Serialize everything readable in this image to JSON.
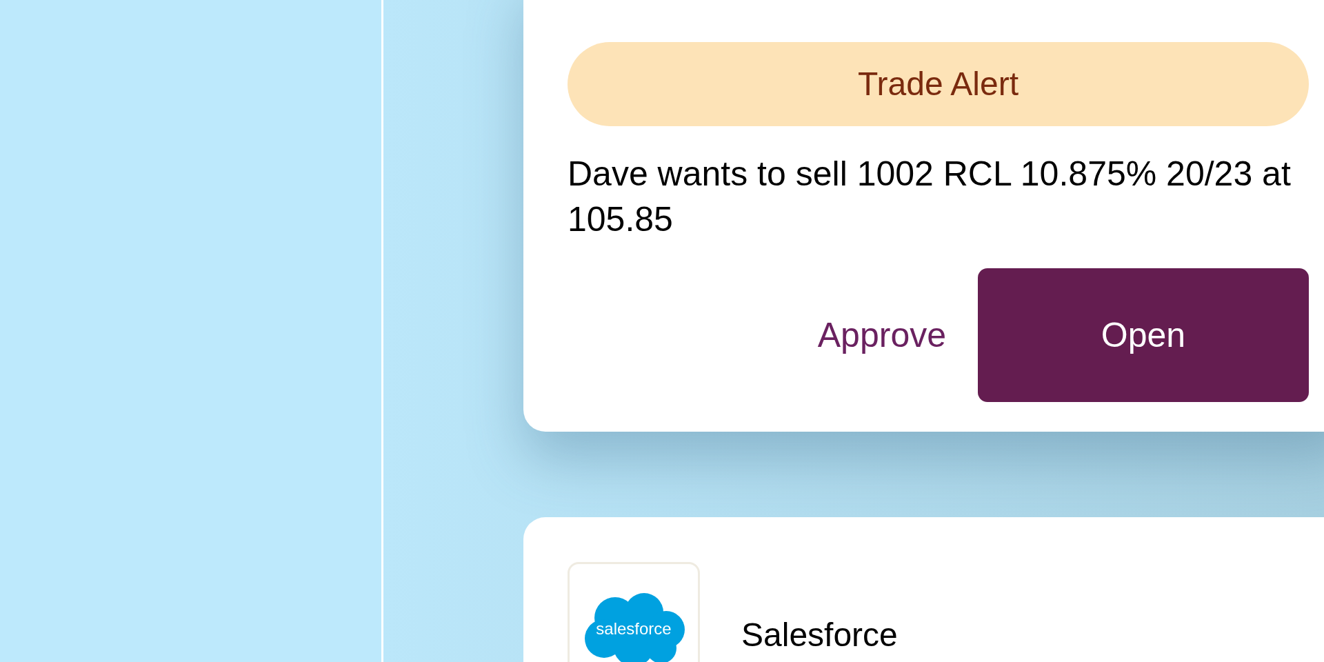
{
  "alert": {
    "badge": "Trade Alert",
    "message": "Dave wants to sell 1002 RCL 10.875% 20/23 at 105.85",
    "actions": [
      {
        "label": "Approve",
        "kind": "link"
      },
      {
        "label": "Open",
        "kind": "primary"
      }
    ]
  },
  "integrations": [
    {
      "logo_text": "salesforce",
      "name": "Salesforce"
    }
  ]
}
